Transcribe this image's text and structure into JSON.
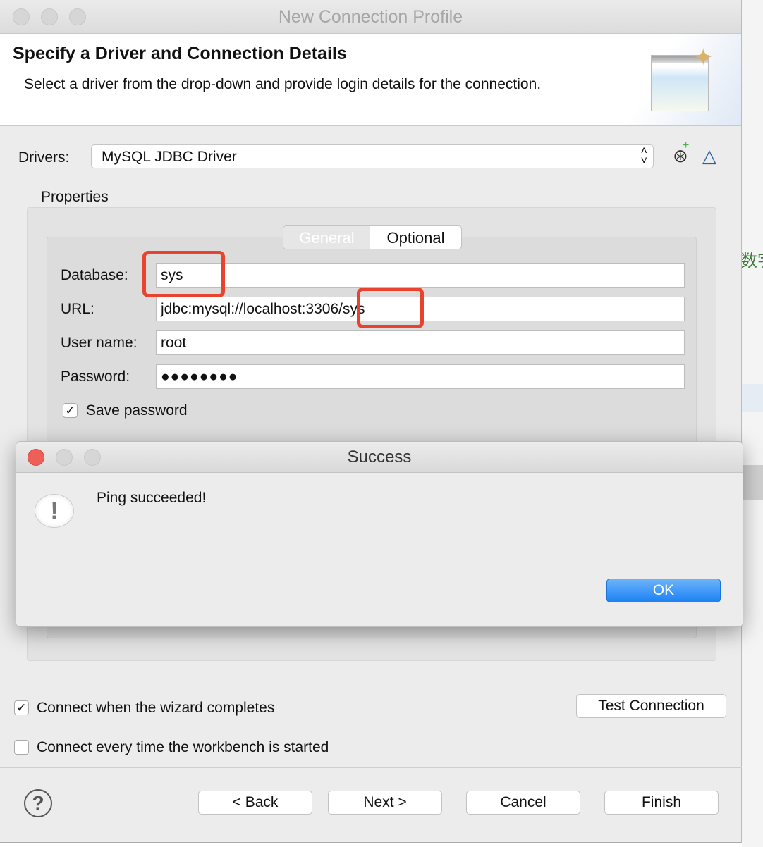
{
  "background_app": {
    "text": "数宇"
  },
  "window": {
    "title": "New Connection Profile"
  },
  "header": {
    "title": "Specify a Driver and Connection Details",
    "description": "Select a driver from the drop-down and provide login details for the connection."
  },
  "drivers": {
    "label": "Drivers:",
    "selected": "MySQL JDBC Driver",
    "icons": [
      "new-driver-icon",
      "edit-driver-icon"
    ]
  },
  "properties": {
    "label": "Properties",
    "tabs": [
      {
        "label": "General",
        "active": true
      },
      {
        "label": "Optional",
        "active": false
      }
    ],
    "fields": [
      {
        "label": "Database:",
        "value": "sys"
      },
      {
        "label": "URL:",
        "value": "jdbc:mysql://localhost:3306/sys"
      },
      {
        "label": "User name:",
        "value": "root"
      },
      {
        "label": "Password:",
        "value": "●●●●●●●●"
      }
    ],
    "save_password": {
      "label": "Save password",
      "checked": true
    }
  },
  "options": {
    "connect_on_finish": {
      "label": "Connect when the wizard completes",
      "checked": true
    },
    "connect_on_start": {
      "label": "Connect every time the workbench is started",
      "checked": false
    },
    "test_connection": "Test Connection"
  },
  "footer": {
    "back": "< Back",
    "next": "Next >",
    "cancel": "Cancel",
    "finish": "Finish"
  },
  "dialog": {
    "title": "Success",
    "message": "Ping succeeded!",
    "ok": "OK",
    "icon": "warning-bubble-icon"
  },
  "colors": {
    "highlight": "#e8432f",
    "ok_button": "#1c82f5",
    "close_button": "#ee5f57"
  }
}
